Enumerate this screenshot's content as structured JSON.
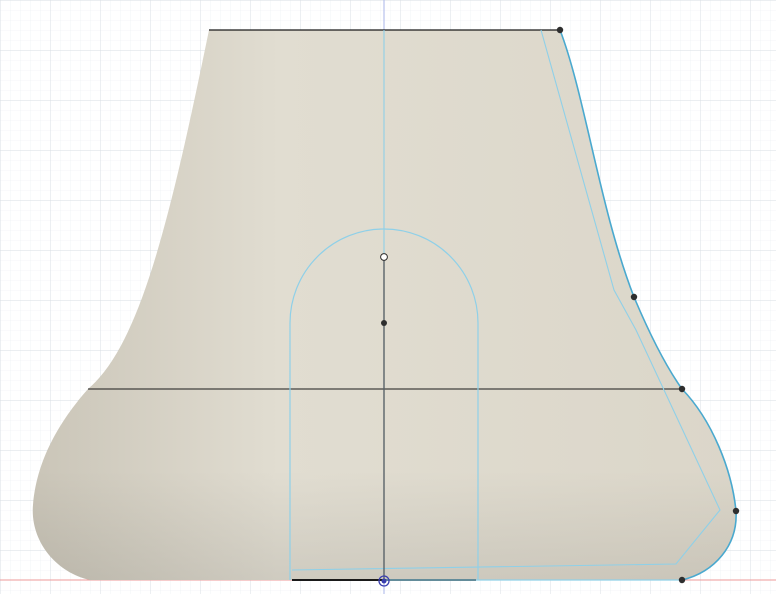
{
  "app": {
    "view": "sketch-canvas-3d-viewport"
  },
  "colors": {
    "background": "#ffffff",
    "grid_minor": "#e9eef2",
    "grid_major": "#d7dde3",
    "body_fill_light": "#e1ddd1",
    "body_fill_mid": "#dbd6c9",
    "body_fill_shadow": "#cac5b8",
    "sketch_line": "#8fd0e8",
    "profile_line": "#4aa9cf",
    "edge_black": "#1a1a1a",
    "sketch_point": "#2e2e2e",
    "origin_point": "#3a3fb0",
    "axis_red": "#ee9a9a",
    "axis_blue": "#a9b6ea"
  },
  "icons": {
    "sketch_point": "filled-circle",
    "center_point": "hollow-circle",
    "origin": "origin-marker"
  }
}
